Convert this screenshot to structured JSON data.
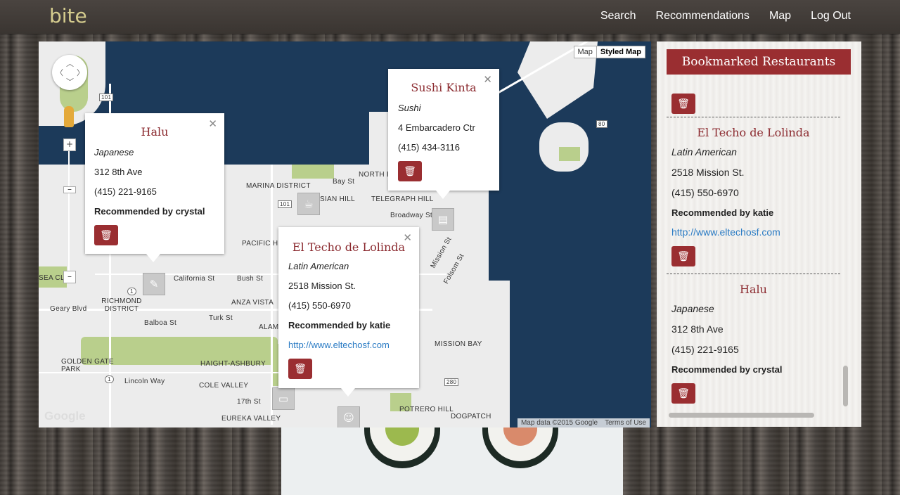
{
  "app": {
    "logo": "bite"
  },
  "nav": {
    "items": [
      "Search",
      "Recommendations",
      "Map",
      "Log Out"
    ]
  },
  "map": {
    "type_buttons": [
      "Map",
      "Styled Map"
    ],
    "active_type": "Styled Map",
    "attribution": "Map data ©2015 Google",
    "terms": "Terms of Use",
    "google_logo": "Google",
    "labels": [
      {
        "text": "MARINA DISTRICT",
        "key": "marina"
      },
      {
        "text": "RUSSIAN HILL",
        "key": "russian"
      },
      {
        "text": "TELEGRAPH HILL",
        "key": "telegraph"
      },
      {
        "text": "NORTH BE",
        "key": "northbeach"
      },
      {
        "text": "Bay St",
        "key": "bayst"
      },
      {
        "text": "Broadway St",
        "key": "broadway"
      },
      {
        "text": "PACIFIC HE",
        "key": "pacific"
      },
      {
        "text": "California St",
        "key": "california"
      },
      {
        "text": "Bush St",
        "key": "bush"
      },
      {
        "text": "RICHMOND DISTRICT",
        "key": "richmond"
      },
      {
        "text": "Geary Blvd",
        "key": "geary"
      },
      {
        "text": "ANZA VISTA",
        "key": "anza"
      },
      {
        "text": "Turk St",
        "key": "turk"
      },
      {
        "text": "ALAMO",
        "key": "alamo"
      },
      {
        "text": "Balboa St",
        "key": "balboa"
      },
      {
        "text": "GOLDEN GATE PARK",
        "key": "ggpark"
      },
      {
        "text": "HAIGHT-ASHBURY",
        "key": "haight"
      },
      {
        "text": "Lincoln Way",
        "key": "lincoln"
      },
      {
        "text": "COLE VALLEY",
        "key": "cole"
      },
      {
        "text": "17th St",
        "key": "s17"
      },
      {
        "text": "EUREKA VALLEY",
        "key": "eureka"
      },
      {
        "text": "MISSION BAY",
        "key": "missionbay"
      },
      {
        "text": "POTRERO HILL",
        "key": "potrero"
      },
      {
        "text": "DOGPATCH",
        "key": "dogpatch"
      },
      {
        "text": "SEA CLI",
        "key": "seacliff"
      },
      {
        "text": "Mission St",
        "key": "missionst"
      },
      {
        "text": "Folsom St",
        "key": "folsom"
      }
    ],
    "highway_shields": [
      "101",
      "101",
      "80",
      "280",
      "1",
      "1"
    ]
  },
  "infowindows": [
    {
      "name": "Halu",
      "cuisine": "Japanese",
      "address": "312 8th Ave",
      "phone": "(415) 221-9165",
      "recommended": "Recommended by crystal"
    },
    {
      "name": "Sushi Kinta",
      "cuisine": "Sushi",
      "address": "4 Embarcadero Ctr",
      "phone": "(415) 434-3116"
    },
    {
      "name": "El Techo de Lolinda",
      "cuisine": "Latin American",
      "address": "2518 Mission St.",
      "phone": "(415) 550-6970",
      "recommended": "Recommended by katie",
      "url": "http://www.eltechosf.com"
    }
  ],
  "sidebar": {
    "title": "Bookmarked Restaurants",
    "entries": [
      {
        "name": "El Techo de Lolinda",
        "cuisine": "Latin American",
        "address": "2518 Mission St.",
        "phone": "(415) 550-6970",
        "recommended": "Recommended by katie",
        "url": "http://www.eltechosf.com"
      },
      {
        "name": "Halu",
        "cuisine": "Japanese",
        "address": "312 8th Ave",
        "phone": "(415) 221-9165",
        "recommended": "Recommended by crystal"
      }
    ]
  },
  "icons": {
    "delete": "trash-icon",
    "close": "close-icon",
    "zoom_in": "plus-icon",
    "zoom_out": "minus-icon",
    "pegman": "pegman-icon",
    "pan": "pan-control-icon"
  }
}
